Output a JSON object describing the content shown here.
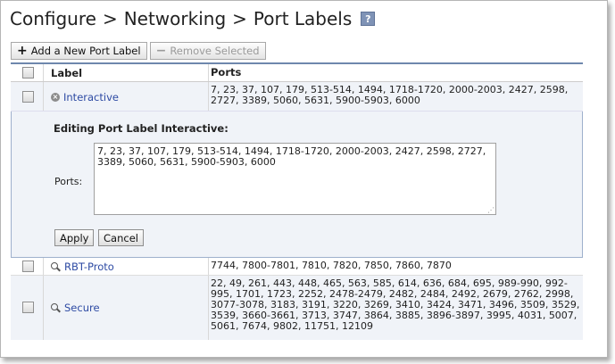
{
  "breadcrumb": {
    "items": [
      "Configure",
      "Networking",
      "Port Labels"
    ],
    "separator": ">"
  },
  "help": {
    "glyph": "?"
  },
  "toolbar": {
    "add_label": "Add a New Port Label",
    "remove_label": "Remove Selected"
  },
  "table": {
    "headers": {
      "label": "Label",
      "ports": "Ports"
    },
    "rows": [
      {
        "label": "Interactive",
        "ports": "7, 23, 37, 107, 179, 513-514, 1494, 1718-1720, 2000-2003, 2427, 2598, 2727, 3389, 5060, 5631, 5900-5903, 6000"
      },
      {
        "label": "RBT-Proto",
        "ports": "7744, 7800-7801, 7810, 7820, 7850, 7860, 7870"
      },
      {
        "label": "Secure",
        "ports": "22, 49, 261, 443, 448, 465, 563, 585, 614, 636, 684, 695, 989-990, 992-995, 1701, 1723, 2252, 2478-2479, 2482, 2484, 2492, 2679, 2762, 2998, 3077-3078, 3183, 3191, 3220, 3269, 3410, 3424, 3471, 3496, 3509, 3529, 3539, 3660-3661, 3713, 3747, 3864, 3885, 3896-3897, 3995, 4031, 5007, 5061, 7674, 9802, 11751, 12109"
      }
    ]
  },
  "editor": {
    "title": "Editing Port Label Interactive:",
    "ports_label": "Ports:",
    "ports_value": "7, 23, 37, 107, 179, 513-514, 1494, 1718-1720, 2000-2003, 2427, 2598, 2727, 3389, 5060, 5631, 5900-5903, 6000",
    "apply_label": "Apply",
    "cancel_label": "Cancel"
  }
}
